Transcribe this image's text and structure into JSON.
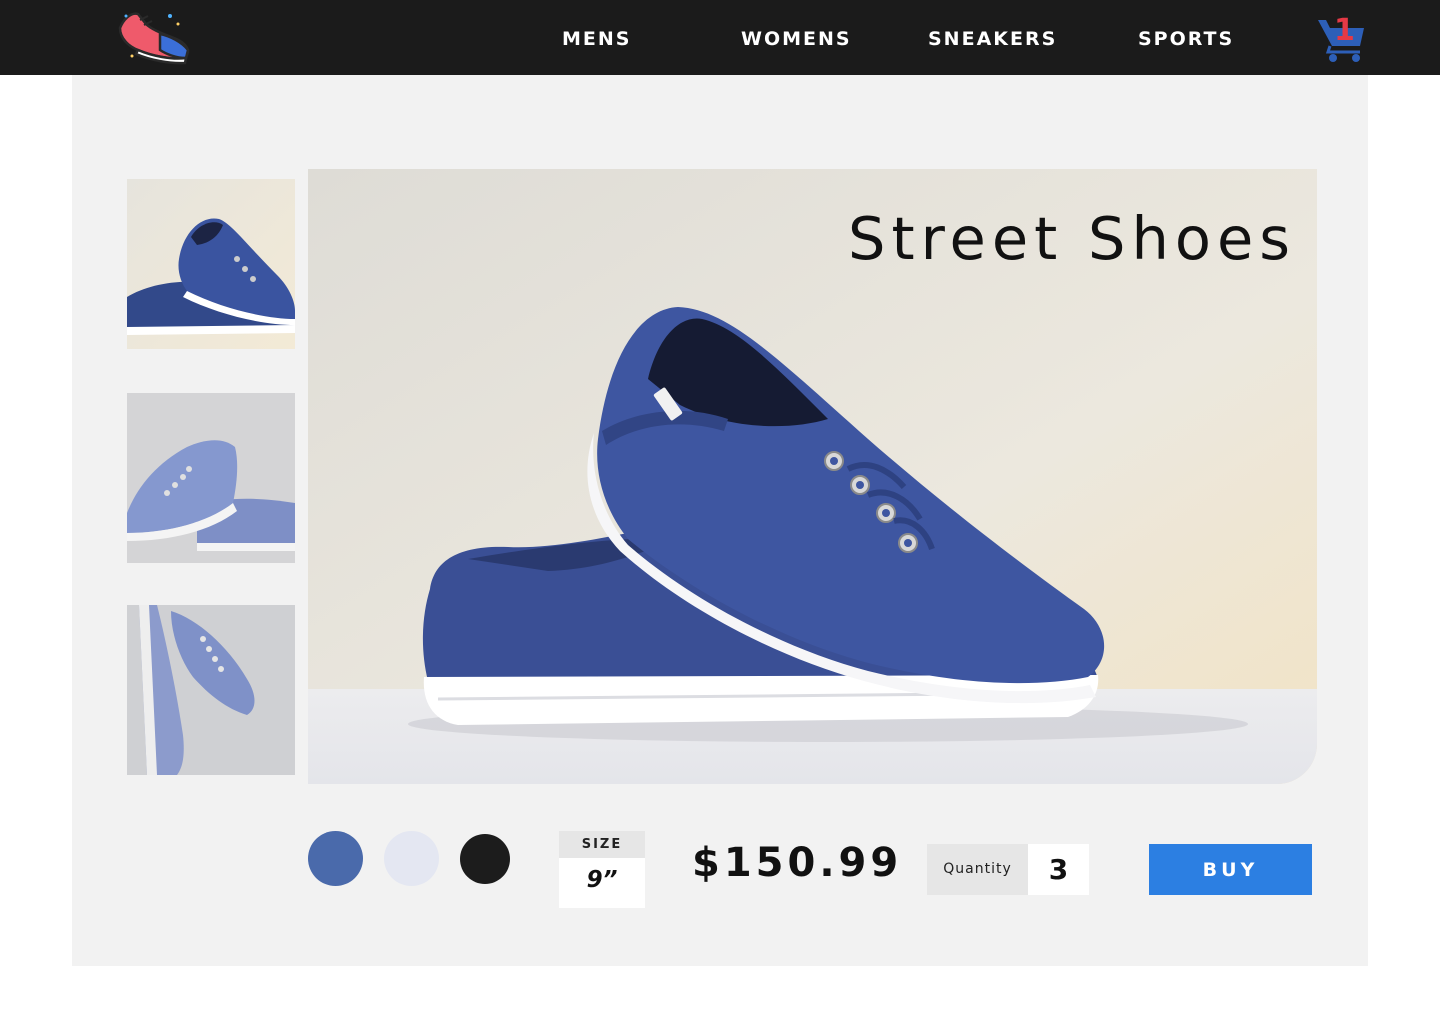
{
  "nav": {
    "items": [
      {
        "label": "MENS"
      },
      {
        "label": "WOMENS"
      },
      {
        "label": "SNEAKERS"
      },
      {
        "label": "SPORTS"
      }
    ],
    "cart_count": "1",
    "logo_icon": "sneaker-logo-icon",
    "cart_icon": "shopping-cart-icon"
  },
  "product": {
    "title": "Street Shoes",
    "price": "$150.99",
    "size_label": "SIZE",
    "size_value": "9”",
    "quantity_label": "Quantity",
    "quantity_value": "3",
    "buy_label": "BUY",
    "colors": [
      {
        "name": "blue",
        "hex": "#4a6aab"
      },
      {
        "name": "light-lavender",
        "hex": "#e4e7f2"
      },
      {
        "name": "black",
        "hex": "#1c1c1c"
      }
    ]
  },
  "theme": {
    "topbar": "#1b1b1b",
    "accent": "#2c7fe2",
    "panel": "#f2f2f2",
    "cart_badge": "#e53946"
  }
}
